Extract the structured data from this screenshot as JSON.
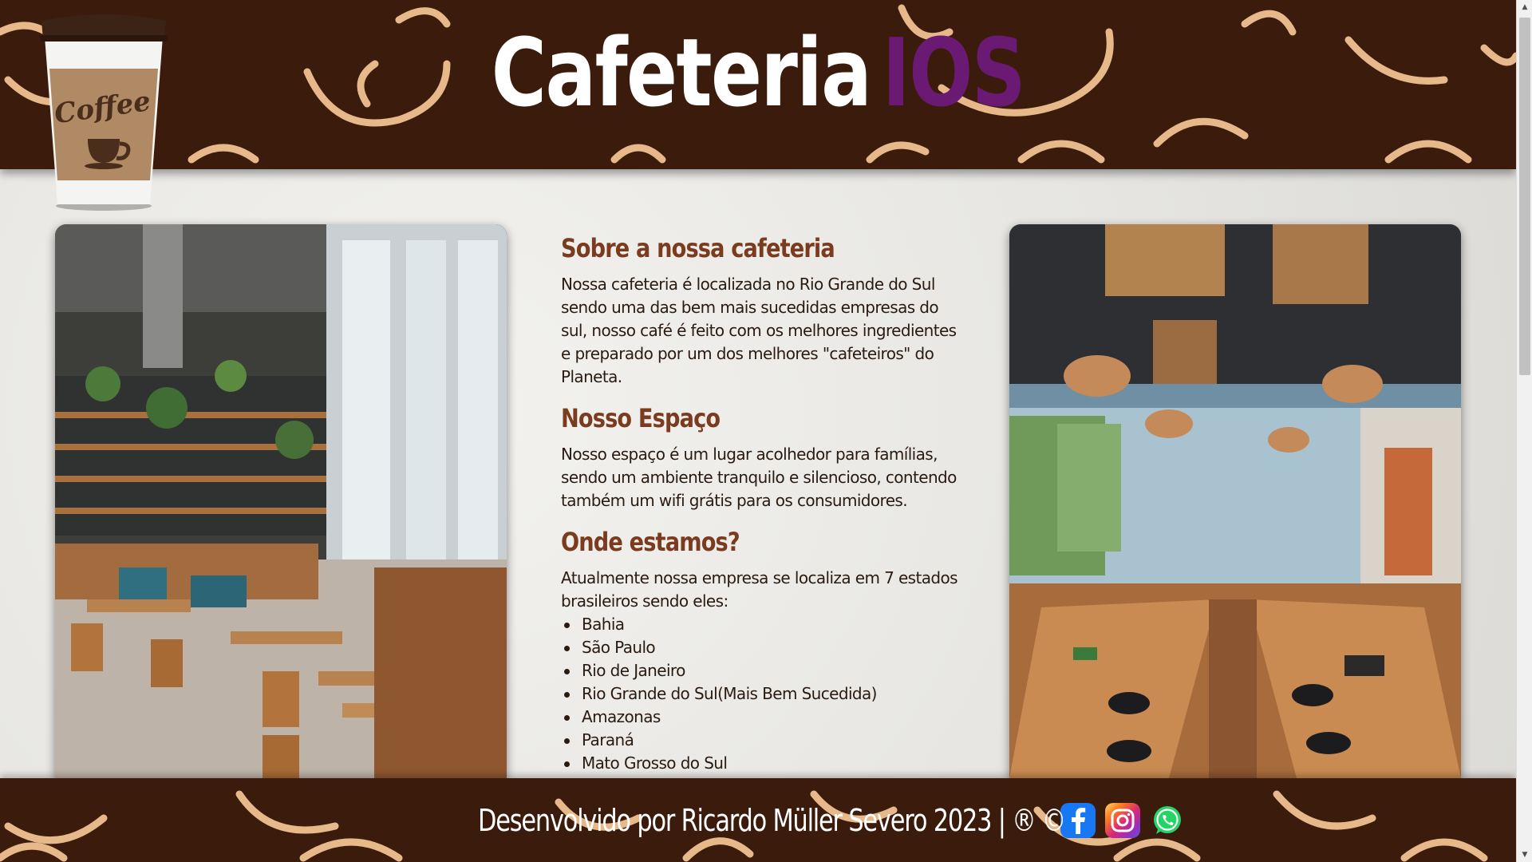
{
  "header": {
    "title_main": "Cafeteria",
    "title_accent": "IOS",
    "logo_cup_text": "Coffee"
  },
  "content": {
    "sections": [
      {
        "heading": "Sobre a nossa cafeteria",
        "text": "Nossa cafeteria é localizada no Rio Grande do Sul sendo uma das bem mais sucedidas empresas do sul, nosso café é feito com os melhores ingredientes e preparado por um dos melhores \"cafeteiros\" do Planeta."
      },
      {
        "heading": "Nosso Espaço",
        "text": "Nosso espaço é um lugar acolhedor para famílias, sendo um ambiente tranquilo e silencioso, contendo também um wifi grátis para os consumidores."
      },
      {
        "heading": "Onde estamos?",
        "text": "Atualmente nossa empresa se localiza em 7 estados brasileiros sendo eles:"
      }
    ],
    "states": [
      "Bahia",
      "São Paulo",
      "Rio de Janeiro",
      "Rio Grande do Sul(Mais Bem Sucedida)",
      "Amazonas",
      "Paraná",
      "Mato Grosso do Sul"
    ]
  },
  "footer": {
    "text": "Desenvolvido por Ricardo Müller Severo 2023 | ® ©",
    "social": [
      "facebook-icon",
      "instagram-icon",
      "whatsapp-icon"
    ]
  },
  "colors": {
    "band_brown": "#3a1b0c",
    "pattern_tan": "#e7b98a",
    "heading_brown": "#7b3b1e",
    "title_accent_purple": "#6b1a73"
  }
}
